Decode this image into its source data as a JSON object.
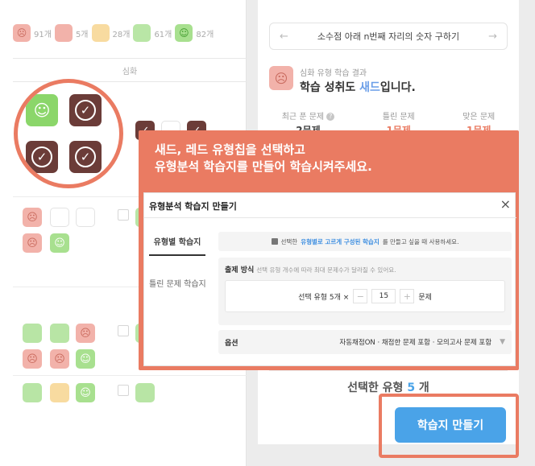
{
  "left": {
    "stats": [
      {
        "chip": "sad",
        "count": "91개"
      },
      {
        "chip": "red",
        "count": "5개"
      },
      {
        "chip": "yellow",
        "count": "28개"
      },
      {
        "chip": "green",
        "count": "61개"
      },
      {
        "chip": "smile",
        "count": "82개"
      }
    ],
    "section_header": "심화"
  },
  "right": {
    "problem_title": "소수점 아래 n번째 자리의 숫자 구하기",
    "result_sub": "심화 유형 학습 결과",
    "result_main_prefix": "학습 성취도 ",
    "result_main_highlight": "새드",
    "result_main_suffix": "입니다.",
    "stats": [
      {
        "label": "최근 푼 문제",
        "value": "2문제"
      },
      {
        "label": "틀린 문제",
        "value": "1문제"
      },
      {
        "label": "맞은 문제",
        "value": "1문제"
      }
    ],
    "selected_prefix": "선택한 유형 ",
    "selected_num": "5",
    "selected_suffix": " 개"
  },
  "callout": {
    "line1": "새드, 레드 유형칩을 선택하고",
    "line2": "유형분석 학습지를 만들어 학습시켜주세요."
  },
  "modal": {
    "title": "유형분석 학습지 만들기",
    "close": "×",
    "tab_active": "유형별 학습지",
    "tab_inactive": "틀린 문제 학습지",
    "notice_prefix": "선택한 ",
    "notice_highlight": "유형별로 고르게 구성된 학습지",
    "notice_suffix": "를 만들고 싶을 때 사용하세요.",
    "count_title": "출제 방식",
    "count_sub": "선택 유형 개수에 따라 최대 문제수가 달라질 수 있어요.",
    "count_prefix": "선택 유형 5개 ×",
    "minus": "−",
    "count_value": "15",
    "plus": "+",
    "count_suffix": "문제",
    "option_label": "옵션",
    "option_value": "자동채점ON · 채점한 문제 포함 · 모의고사 문제 포함",
    "option_chevron": "▼"
  },
  "cta": {
    "label": "학습지 만들기"
  },
  "colors": {
    "accent": "#ea7b62",
    "primary": "#4aa3e8",
    "sad": "#f2b2aa",
    "green": "#b8e5a5"
  }
}
